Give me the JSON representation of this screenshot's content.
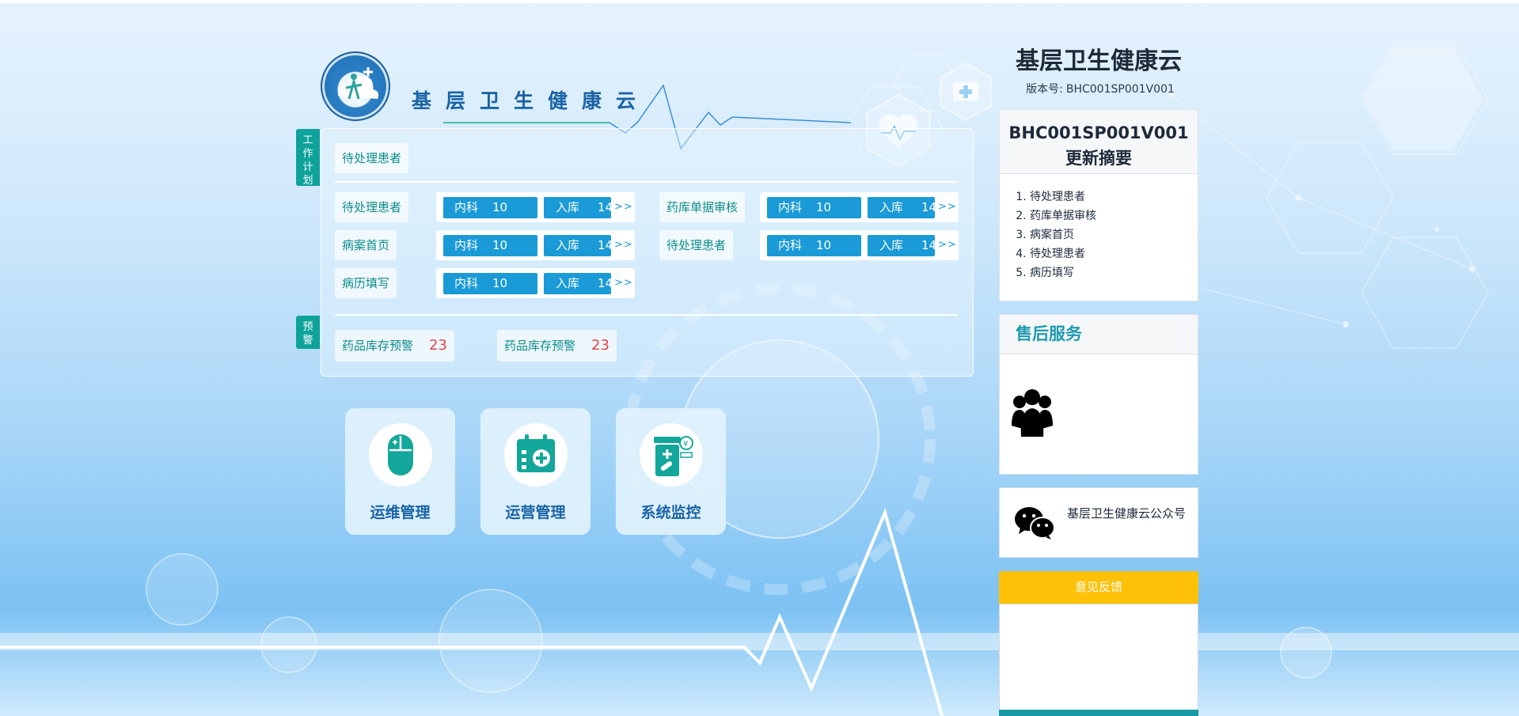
{
  "brand": {
    "name": "基层卫生健康云"
  },
  "work_plan": {
    "tag": [
      "工",
      "作",
      "计",
      "划"
    ],
    "top_item": "待处理患者",
    "rows": [
      {
        "label": "待处理患者",
        "dept": "内科",
        "dept_count": "10",
        "stock": "入库",
        "stock_count": "14",
        "more": ">>"
      },
      {
        "label": "药库单据审核",
        "dept": "内科",
        "dept_count": "10",
        "stock": "入库",
        "stock_count": "14",
        "more": ">>"
      },
      {
        "label": "病案首页",
        "dept": "内科",
        "dept_count": "10",
        "stock": "入库",
        "stock_count": "14",
        "more": ">>"
      },
      {
        "label": "待处理患者",
        "dept": "内科",
        "dept_count": "10",
        "stock": "入库",
        "stock_count": "14",
        "more": ">>"
      },
      {
        "label": "病历填写",
        "dept": "内科",
        "dept_count": "10",
        "stock": "入库",
        "stock_count": "14",
        "more": ">>"
      }
    ]
  },
  "warning": {
    "tag": [
      "预",
      "警"
    ],
    "items": [
      {
        "label": "药品库存预警",
        "count": "23"
      },
      {
        "label": "药品库存预警",
        "count": "23"
      }
    ]
  },
  "tiles": [
    {
      "label": "运维管理",
      "icon": "mouse-icon"
    },
    {
      "label": "运营管理",
      "icon": "calendar-plus-icon"
    },
    {
      "label": "系统监控",
      "icon": "medicine-bottle-icon"
    }
  ],
  "sidebar": {
    "title": "基层卫生健康云",
    "version_label": "版本号:",
    "version": "BHC001SP001V001",
    "update_card": {
      "code": "BHC001SP001V001",
      "subtitle": "更新摘要",
      "items": [
        "待处理患者",
        "药库单据审核",
        "病案首页",
        "待处理患者",
        "病历填写"
      ]
    },
    "service": {
      "title": "售后服务",
      "icon": "people-icon"
    },
    "wechat": {
      "text": "基层卫生健康云公众号",
      "icon": "wechat-icon"
    },
    "feedback": {
      "title": "意见反馈",
      "placeholder": ""
    }
  },
  "colors": {
    "accent": "#1a9ad6",
    "teal": "#0ea39a",
    "warning_number": "#e04545",
    "feedback": "#ffc107"
  }
}
